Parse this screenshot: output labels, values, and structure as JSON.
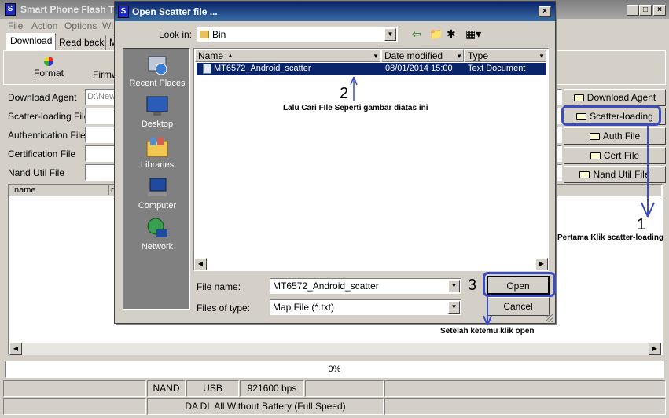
{
  "app": {
    "title": "Smart Phone Flash To",
    "menu": [
      "File",
      "Action",
      "Options",
      "Wi"
    ],
    "tabs": [
      "Download",
      "Read back",
      "M"
    ],
    "toolbar": {
      "format": "Format",
      "firmware": "Firmw"
    },
    "fields": [
      {
        "label": "Download Agent",
        "value": "D:\\New"
      },
      {
        "label": "Scatter-loading File",
        "value": ""
      },
      {
        "label": "Authentication File",
        "value": ""
      },
      {
        "label": "Certification File",
        "value": ""
      },
      {
        "label": "Nand Util File",
        "value": ""
      }
    ],
    "buttons": [
      "Download Agent",
      "Scatter-loading",
      "Auth File",
      "Cert File",
      "Nand Util File"
    ],
    "list_headers": [
      "name",
      "re"
    ],
    "progress_text": "0%",
    "status": [
      "NAND",
      "USB",
      "921600 bps"
    ],
    "footer_status": "DA DL All Without Battery (Full Speed)"
  },
  "dialog": {
    "title": "Open Scatter file ...",
    "look_in_label": "Look in:",
    "look_in_value": "Bin",
    "places": [
      "Recent Places",
      "Desktop",
      "Libraries",
      "Computer",
      "Network"
    ],
    "columns": [
      "Name",
      "Date modified",
      "Type"
    ],
    "files": [
      {
        "name": "MT6572_Android_scatter",
        "date": "08/01/2014 15:00",
        "type": "Text Document"
      }
    ],
    "file_name_label": "File name:",
    "file_name_value": "MT6572_Android_scatter",
    "file_type_label": "Files of type:",
    "file_type_value": "Map File (*.txt)",
    "open_label": "Open",
    "cancel_label": "Cancel"
  },
  "annotations": {
    "step1_number": "1",
    "step1_text": "Pertama Klik scatter-loading",
    "step2_number": "2",
    "step2_text": "Lalu Cari FIle Seperti gambar diatas ini",
    "step3_number": "3",
    "step3_text": "Setelah ketemu klik open"
  },
  "colors": {
    "annotation": "#3b4cc0",
    "selection": "#0a246a",
    "dialog_title": "#0a246a"
  }
}
